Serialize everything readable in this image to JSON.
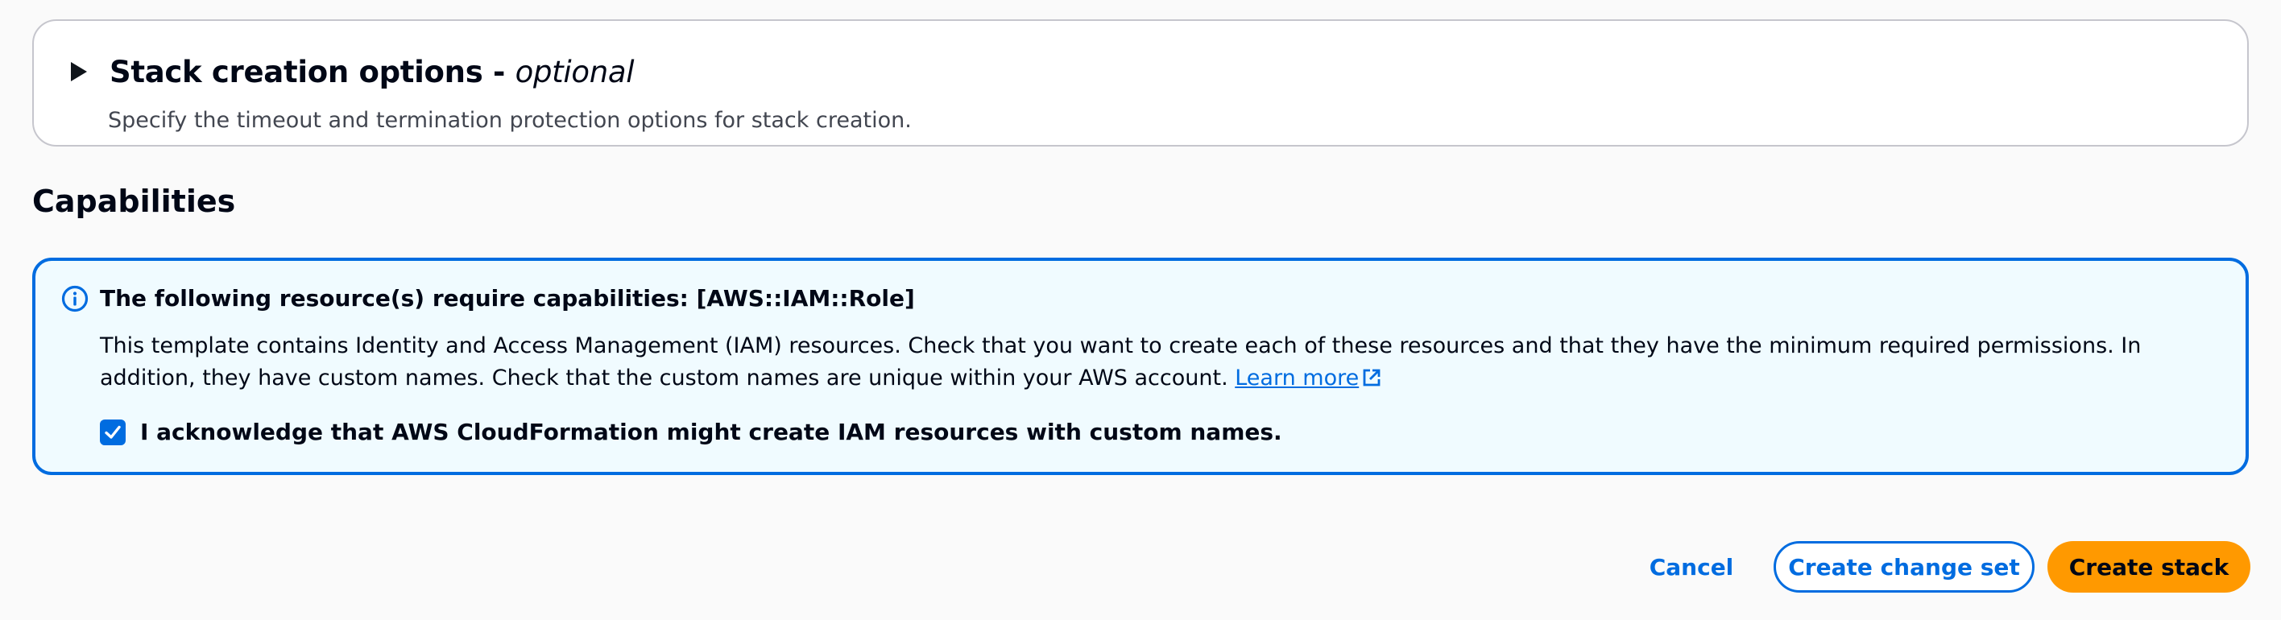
{
  "stack_options": {
    "title": "Stack creation options - ",
    "title_emphasis": "optional",
    "description": "Specify the timeout and termination protection options for stack creation."
  },
  "capabilities": {
    "heading": "Capabilities",
    "alert": {
      "header": "The following resource(s) require capabilities: [AWS::IAM::Role]",
      "body": "This template contains Identity and Access Management (IAM) resources. Check that you want to create each of these resources and that they have the minimum required permissions. In addition, they have custom names. Check that the custom names are unique within your AWS account. ",
      "learn_more": "Learn more",
      "acknowledge_label": "I acknowledge that AWS CloudFormation might create IAM resources with custom names.",
      "acknowledge_checked": true
    }
  },
  "footer": {
    "cancel_label": "Cancel",
    "change_set_label": "Create change set",
    "create_label": "Create stack"
  },
  "colors": {
    "accent": "#006ce0",
    "primary_button": "#ff9900",
    "alert_background": "#f0fbff"
  }
}
